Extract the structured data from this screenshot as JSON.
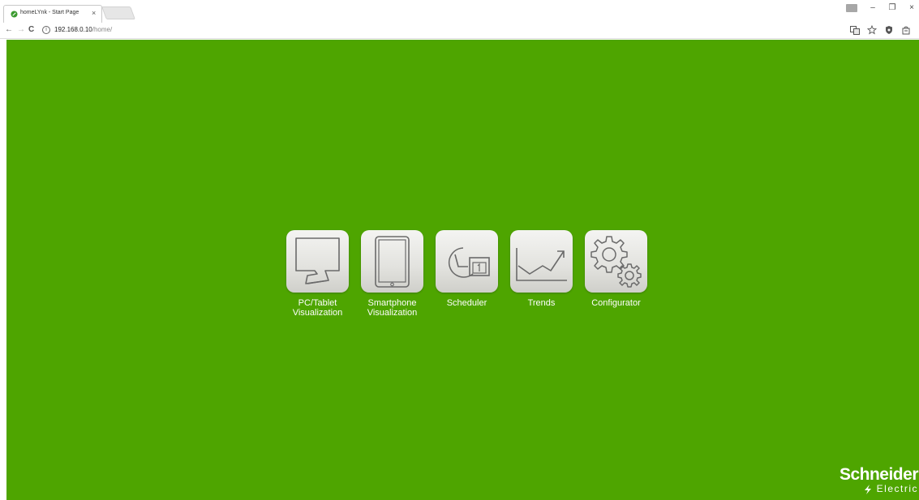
{
  "browser": {
    "tab_title": "homeLYnk - Start Page",
    "tab_close": "×",
    "url_host": "192.168.0.10",
    "url_path": "/home/",
    "window_controls": {
      "minimize": "–",
      "maximize": "❐",
      "close": "×"
    },
    "nav": {
      "back": "←",
      "forward": "→",
      "reload": "C",
      "info": "i"
    },
    "toolbar_icons": [
      "translate-icon",
      "star-icon",
      "shield-icon",
      "extension-icon"
    ]
  },
  "apps": [
    {
      "label": "PC/Tablet\nVisualization",
      "icon": "monitor-icon"
    },
    {
      "label": "Smartphone\nVisualization",
      "icon": "tablet-icon"
    },
    {
      "label": "Scheduler",
      "icon": "scheduler-icon"
    },
    {
      "label": "Trends",
      "icon": "trend-chart-icon"
    },
    {
      "label": "Configurator",
      "icon": "gears-icon"
    }
  ],
  "brand": {
    "name_top": "Schneider",
    "name_bottom": "Electric"
  },
  "colors": {
    "background": "#4ea500",
    "tile": "#e6e6e2",
    "icon_stroke": "#6a6a6a"
  }
}
